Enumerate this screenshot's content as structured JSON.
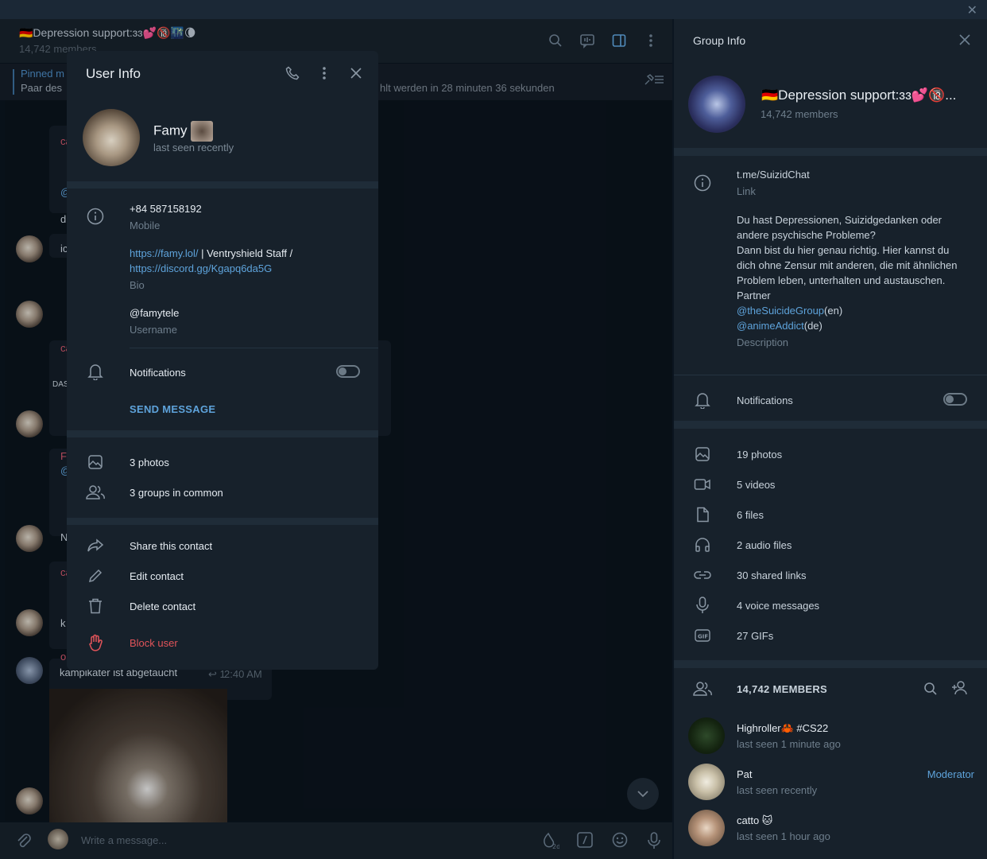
{
  "chat": {
    "title": "🇩🇪Depression support:ɜɜ💕🔞🌃🌘",
    "members": "14,742 members",
    "pinned_title": "Pinned m",
    "pinned_text": "Paar des ",
    "pinned_more": "hlt werden in 28 minuten 36 sekunden",
    "composer_placeholder": "Write a message...",
    "last_msg_text": "kampikater ist abgetaucht",
    "last_msg_time": "2:40 AM",
    "last_msg_reply_count": "1",
    "snippets": [
      "ca",
      "@",
      "d",
      "ic",
      "ca",
      "DAS",
      "Fa",
      "@",
      "N",
      "ca",
      "k",
      "o"
    ]
  },
  "modal": {
    "title": "User Info",
    "name": "Famy",
    "status": "last seen recently",
    "phone": "+84 587158192",
    "phone_label": "Mobile",
    "bio_link1": "https://famy.lol/",
    "bio_mid": " | Ventryshield Staff /",
    "bio_link2": "https://discord.gg/Kgapq6da5G",
    "bio_label": "Bio",
    "username": "@famytele",
    "username_label": "Username",
    "notifications": "Notifications",
    "send_message": "SEND MESSAGE",
    "photos": "3 photos",
    "groups": "3 groups in common",
    "share": "Share this contact",
    "edit": "Edit contact",
    "delete": "Delete contact",
    "block": "Block user"
  },
  "panel": {
    "title": "Group Info",
    "group_name": "🇩🇪Depression support:ɜɜ💕🔞...",
    "members": "14,742 members",
    "link": "t.me/SuizidChat",
    "link_label": "Link",
    "desc_1": "Du hast Depressionen, Suizidgedanken oder andere psychische Probleme?",
    "desc_2": "Dann bist du hier genau richtig. Hier kannst du dich ohne Zensur mit anderen, die mit ähnlichen Problem leben, unterhalten und austauschen.",
    "desc_3": "Partner",
    "partner_1": "@theSuicideGroup",
    "partner_1_suffix": "(en)",
    "partner_2": "@animeAddict",
    "partner_2_suffix": "(de)",
    "desc_label": "Description",
    "notifications": "Notifications",
    "media": [
      "19 photos",
      "5 videos",
      "6 files",
      "2 audio files",
      "30 shared links",
      "4 voice messages",
      "27 GIFs"
    ],
    "members_header": "14,742 MEMBERS",
    "member_list": [
      {
        "name": "Highroller🦀 #CS22",
        "status": "last seen 1 minute ago",
        "role": ""
      },
      {
        "name": "Pat",
        "status": "last seen recently",
        "role": "Moderator"
      },
      {
        "name": "catto 🐱",
        "status": "last seen 1 hour ago",
        "role": ""
      }
    ]
  },
  "colors": {
    "accent": "#5ea3db",
    "danger": "#e2545a",
    "panel_bg": "#17212b",
    "chat_bg": "#0a141e"
  }
}
